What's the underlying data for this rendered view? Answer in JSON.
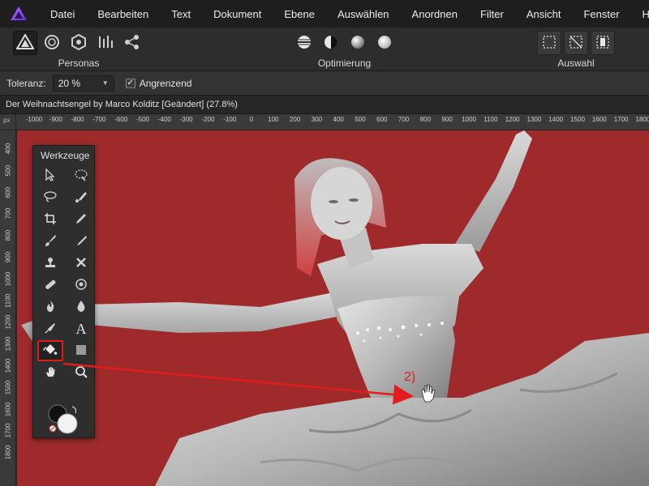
{
  "menu": {
    "items": [
      "Datei",
      "Bearbeiten",
      "Text",
      "Dokument",
      "Ebene",
      "Auswählen",
      "Anordnen",
      "Filter",
      "Ansicht",
      "Fenster",
      "Hilfe"
    ]
  },
  "toolbar": {
    "personas_label": "Personas",
    "optimierung_label": "Optimierung",
    "auswahl_label": "Auswahl"
  },
  "context": {
    "tolerance_label": "Toleranz:",
    "tolerance_value": "20 %",
    "contiguous_label": "Angrenzend",
    "contiguous_checked": true
  },
  "document": {
    "title": "Der Weihnachtsengel by Marco Kolditz [Geändert] (27.8%)"
  },
  "ruler": {
    "unit": "px",
    "h_labels": [
      "-1000",
      "-900",
      "-800",
      "-700",
      "-600",
      "-500",
      "-400",
      "-300",
      "-200",
      "-100",
      "0",
      "100",
      "200",
      "300",
      "400",
      "500",
      "600",
      "700",
      "800",
      "900",
      "1000",
      "1100",
      "1200",
      "1300",
      "1400",
      "1500",
      "1600",
      "1700",
      "1800"
    ],
    "v_labels": [
      "400",
      "500",
      "600",
      "700",
      "800",
      "900",
      "1000",
      "1100",
      "1200",
      "1300",
      "1400",
      "1500",
      "1600",
      "1700",
      "1800"
    ]
  },
  "tools_panel": {
    "title": "Werkzeuge",
    "tools": [
      "move-tool",
      "selection-brush-tool",
      "freehand-selection-tool",
      "refine-brush-tool",
      "crop-tool",
      "color-picker-tool",
      "paint-brush-tool",
      "brush-tool",
      "clone-tool",
      "retouch-tool",
      "inpainting-tool",
      "red-eye-tool",
      "burn-tool",
      "blur-tool",
      "pen-tool",
      "text-tool",
      "flood-fill-tool",
      "rectangle-tool",
      "view-tool",
      "zoom-tool"
    ],
    "selected_tool": "flood-fill-tool"
  },
  "annotation": {
    "label": "2)",
    "color": "#e01c1c"
  },
  "colors": {
    "canvas_bg": "#9e2a2b",
    "accent": "#e01c1c"
  }
}
